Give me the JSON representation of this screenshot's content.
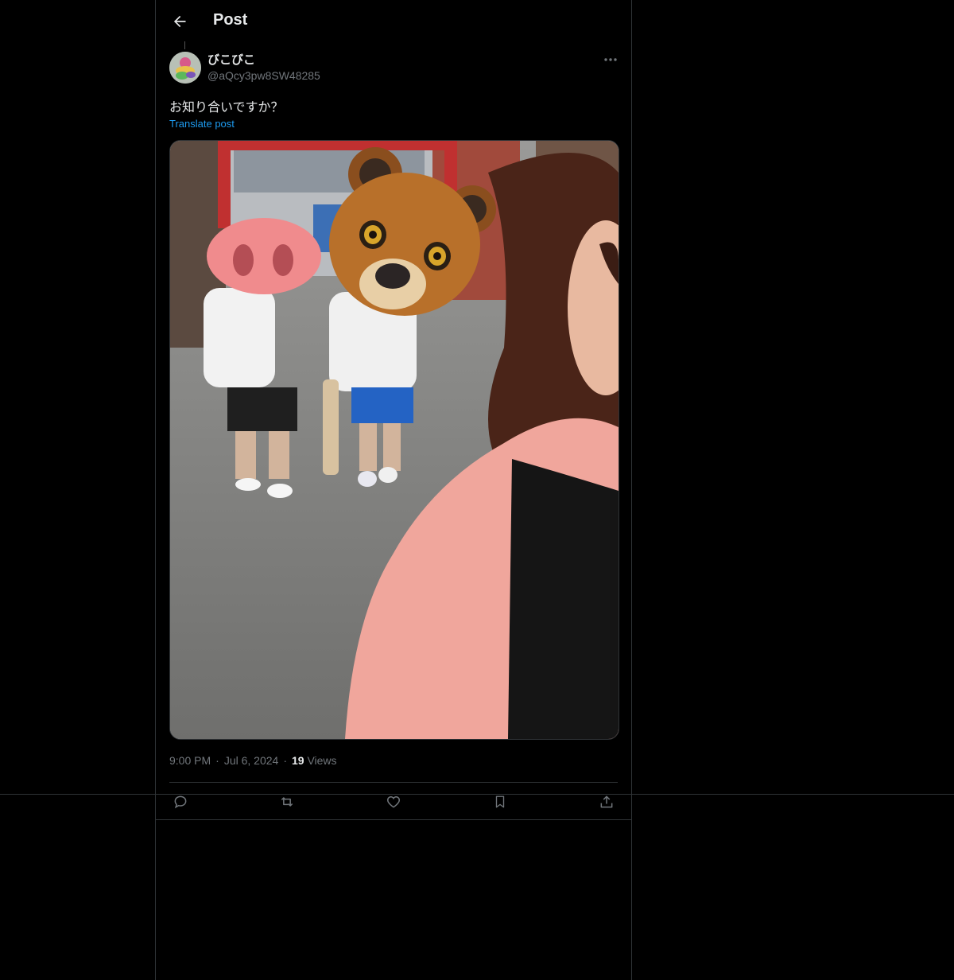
{
  "header": {
    "title": "Post"
  },
  "author": {
    "display_name": "びこびこ",
    "handle": "@aQcy3pw8SW48285"
  },
  "post": {
    "text": "お知り合いですか？",
    "translate_label": "Translate post",
    "time": "9:00 PM",
    "date": "Jul 6, 2024",
    "separator": "·",
    "views_count": "19",
    "views_label": "Views"
  },
  "actions": [
    "reply-icon",
    "repost-icon",
    "like-icon",
    "bookmark-icon",
    "share-icon"
  ],
  "colors": {
    "accent": "#1d9bf0",
    "background": "#000000",
    "border": "#2f3336",
    "muted": "#71767b"
  }
}
